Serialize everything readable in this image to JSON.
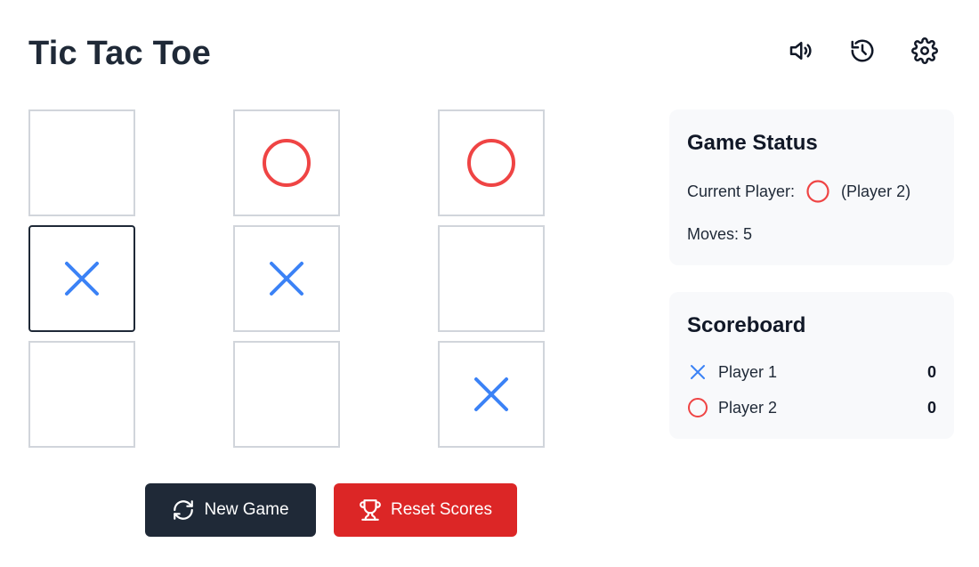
{
  "title": "Tic Tac Toe",
  "header_icons": [
    "speaker-icon",
    "history-icon",
    "gear-icon"
  ],
  "board": {
    "cells": [
      "",
      "O",
      "O",
      "X",
      "X",
      "",
      "",
      "",
      "X"
    ],
    "focused_cell": 3
  },
  "buttons": {
    "new_game": "New Game",
    "reset_scores": "Reset Scores"
  },
  "status": {
    "title": "Game Status",
    "current_player_label": "Current Player:",
    "current_player_name": "(Player 2)",
    "moves_label": "Moves: 5"
  },
  "scoreboard": {
    "title": "Scoreboard",
    "players": [
      {
        "mark": "X",
        "name": "Player 1",
        "score": "0"
      },
      {
        "mark": "O",
        "name": "Player 2",
        "score": "0"
      }
    ]
  },
  "colors": {
    "x": "#3b82f6",
    "o": "#ef4444",
    "primary_button": "#1f2937",
    "danger_button": "#dc2626"
  }
}
